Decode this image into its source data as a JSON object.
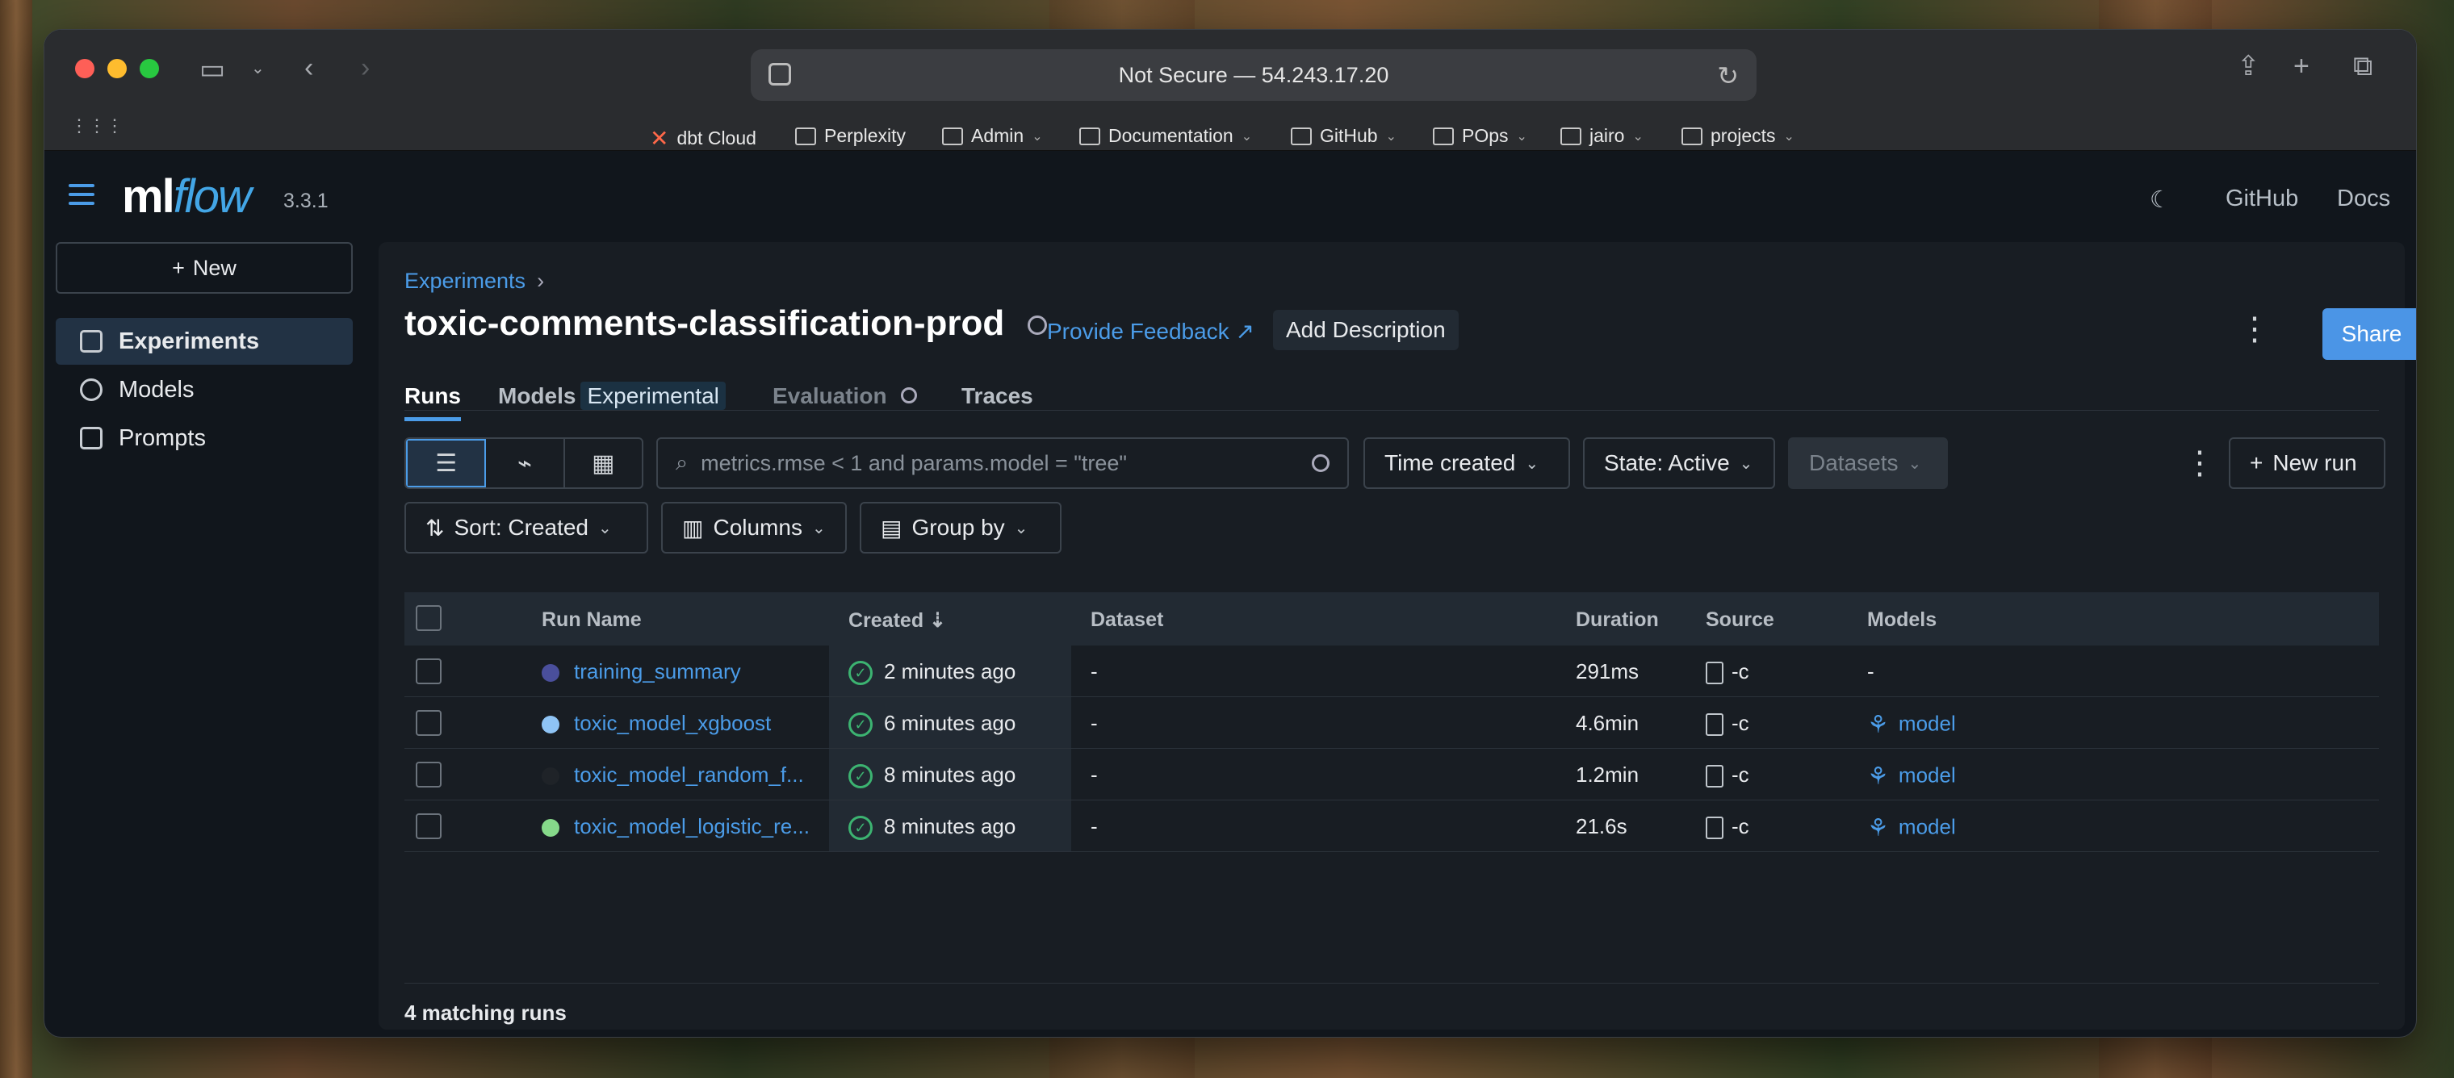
{
  "browser": {
    "address": "Not Secure — 54.243.17.20",
    "bookmarks": [
      "dbt Cloud",
      "Perplexity",
      "Admin",
      "Documentation",
      "GitHub",
      "POps",
      "jairo",
      "projects"
    ]
  },
  "app": {
    "logo_ml": "ml",
    "logo_flow": "flow",
    "version": "3.3.1",
    "header_links": [
      "GitHub",
      "Docs"
    ]
  },
  "sidebar": {
    "new_label": "New",
    "items": [
      {
        "label": "Experiments",
        "icon": "beaker-icon",
        "active": true
      },
      {
        "label": "Models",
        "icon": "models-icon"
      },
      {
        "label": "Prompts",
        "icon": "prompt-icon"
      }
    ]
  },
  "experiment": {
    "breadcrumb": "Experiments",
    "breadcrumb_sep": "›",
    "title": "toxic-comments-classification-prod",
    "feedback": "Provide Feedback",
    "add_description": "Add Description",
    "share": "Share"
  },
  "tabs": [
    {
      "label": "Runs"
    },
    {
      "label": "Models",
      "badge": "Experimental"
    },
    {
      "label": "Evaluation"
    },
    {
      "label": "Traces"
    }
  ],
  "controls": {
    "search_placeholder": "metrics.rmse < 1 and params.model = \"tree\"",
    "time_created": "Time created",
    "state": "State: Active",
    "datasets": "Datasets",
    "new_run": "New run",
    "sort": "Sort: Created",
    "columns": "Columns",
    "group_by": "Group by"
  },
  "table": {
    "columns": [
      "Run Name",
      "Created",
      "Dataset",
      "Duration",
      "Source",
      "Models"
    ],
    "rows": [
      {
        "name": "training_summary",
        "color": "#4a4f9c",
        "created": "2 minutes ago",
        "dataset": "-",
        "duration": "291ms",
        "source": "-c",
        "models": "-"
      },
      {
        "name": "toxic_model_xgboost",
        "color": "#8fc4f5",
        "created": "6 minutes ago",
        "dataset": "-",
        "duration": "4.6min",
        "source": "-c",
        "models": "model"
      },
      {
        "name": "toxic_model_random_f...",
        "color": "#1f2328",
        "created": "8 minutes ago",
        "dataset": "-",
        "duration": "1.2min",
        "source": "-c",
        "models": "model"
      },
      {
        "name": "toxic_model_logistic_re...",
        "color": "#86d98a",
        "created": "8 minutes ago",
        "dataset": "-",
        "duration": "21.6s",
        "source": "-c",
        "models": "model"
      }
    ],
    "footer": "4 matching runs"
  }
}
